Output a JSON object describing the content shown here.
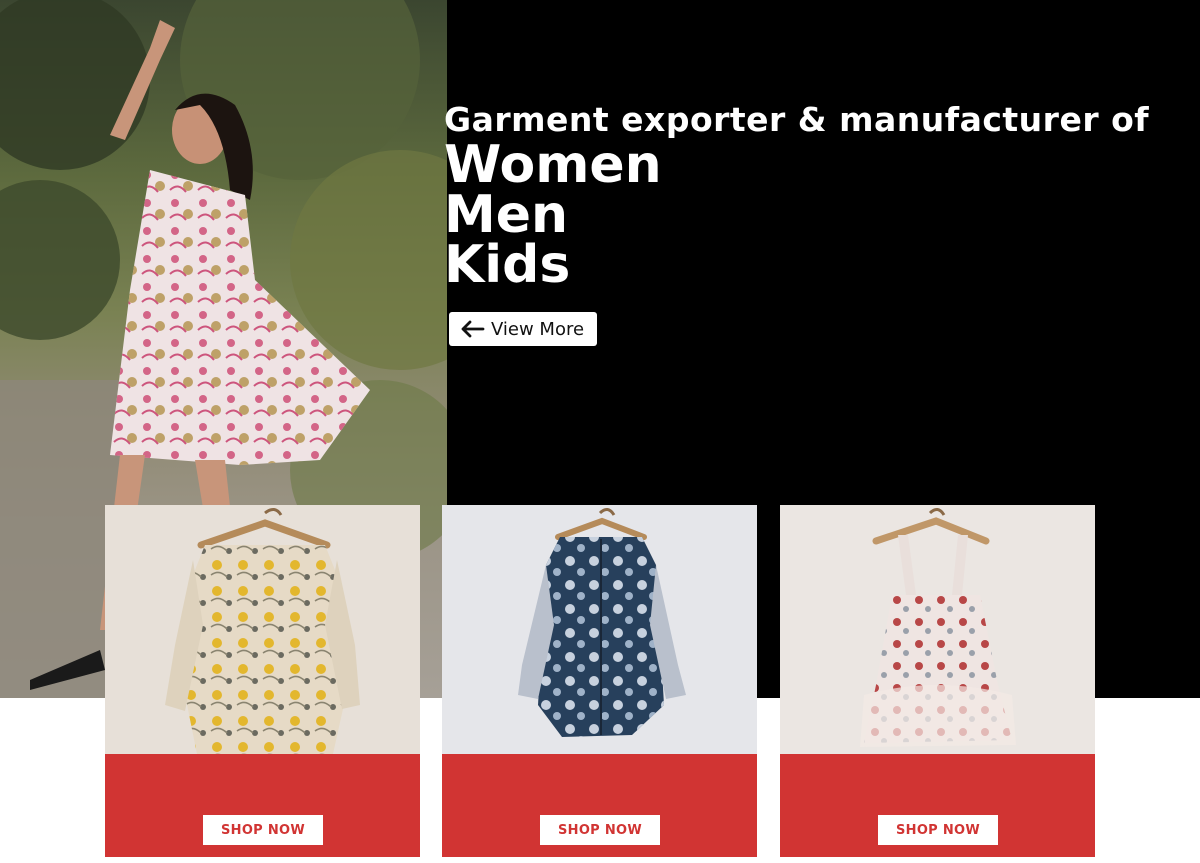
{
  "hero": {
    "tagline": "Garment exporter & manufacturer of",
    "categories": [
      "Women",
      "Men",
      "Kids"
    ],
    "view_more_label": "View More",
    "view_more_icon": "arrow-left-icon"
  },
  "products": [
    {
      "button_label": "SHOP NOW",
      "image": "floral-yellow-smocked-dress-on-hanger"
    },
    {
      "button_label": "SHOP NOW",
      "image": "blue-printed-shirt-dress-on-hanger"
    },
    {
      "button_label": "SHOP NOW",
      "image": "red-printed-pinafore-dress-on-hanger"
    }
  ],
  "colors": {
    "hero_background": "#000000",
    "accent": "#d13433",
    "button_background": "#ffffff"
  }
}
